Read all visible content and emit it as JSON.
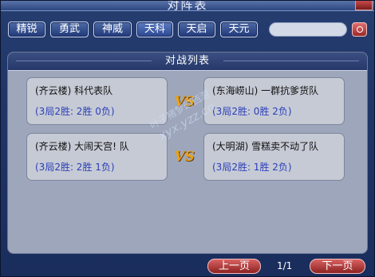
{
  "window": {
    "title": "对阵表"
  },
  "tabs": [
    "精锐",
    "勇武",
    "神威",
    "天科",
    "天启",
    "天元"
  ],
  "search": {
    "value": ""
  },
  "panel": {
    "title": "对战列表"
  },
  "matches": [
    {
      "left": {
        "name": "(齐云楼) 科代表队",
        "stats": "(3局2胜: 2胜 0负)"
      },
      "vs": "VS",
      "right": {
        "name": "(东海崂山) 一群抗爹货队",
        "stats": "(3局2胜: 0胜 2负)"
      }
    },
    {
      "left": {
        "name": "(齐云楼) 大闹天宫! 队",
        "stats": "(3局2胜: 2胜 1负)"
      },
      "vs": "VS",
      "right": {
        "name": "(大明湖) 雪糕卖不动了队",
        "stats": "(3局2胜: 1胜 2负)"
      }
    }
  ],
  "watermark": {
    "line1": "叶子猪梦幻西游",
    "line2": "xyx.yzz.cn"
  },
  "pagination": {
    "prev": "上一页",
    "page": "1/1",
    "next": "下一页"
  }
}
